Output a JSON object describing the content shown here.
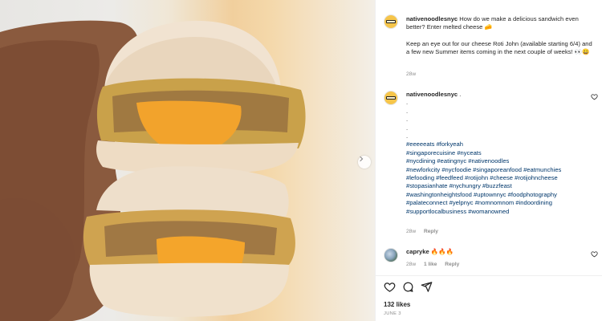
{
  "post": {
    "username": "nativenoodlesnyc",
    "caption": "How do we make a delicious sandwich even better? Enter melted cheese 🧀",
    "caption_p2": "Keep an eye out for our cheese Roti John (available starting 6/4) and a few new Summer items coming in the next couple of weeks! 👀😀",
    "time": "28w"
  },
  "comments": [
    {
      "username": "nativenoodlesnyc",
      "text_head": ".",
      "dots": [
        ".",
        ".",
        ".",
        ".",
        "."
      ],
      "hashtags": [
        "#eeeeeats #forkyeah",
        "#singaporecuisine #nyceats",
        "#nycdining #eatingnyc #nativenoodles",
        "#newforkcity #nycfoodie #singaporeanfood #eatmunchies",
        "#lefooding #feedfeed #rotijohn #cheese #rotijohncheese",
        "#stopasianhate #nychungry #buzzfeast",
        "#washingtonheightsfood #uptownnyc #foodphotography",
        "#palateconnect #yelpnyc #nomnomnom #indoordining",
        "#supportlocalbusiness #womanowned"
      ],
      "time": "28w",
      "reply": "Reply"
    },
    {
      "username": "capryke",
      "text": "🔥🔥🔥",
      "time": "28w",
      "likes": "1 like",
      "reply": "Reply"
    }
  ],
  "footer": {
    "likes": "132 likes",
    "date": "JUNE 3"
  },
  "icons": {
    "like": "heart-icon",
    "comment": "comment-icon",
    "share": "share-icon",
    "next": "chevron-right-icon"
  }
}
